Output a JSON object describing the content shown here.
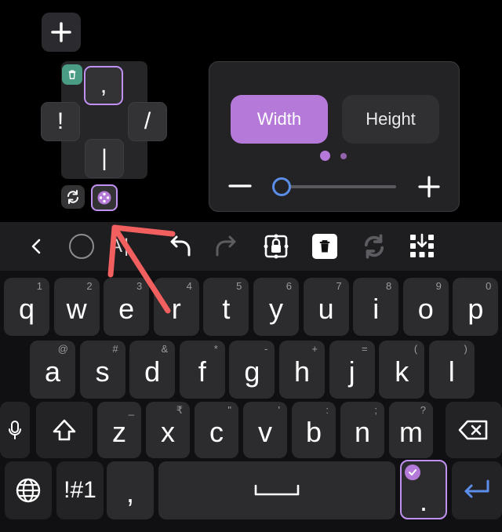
{
  "editor": {
    "add_icon": "plus-icon",
    "cluster": {
      "top_key": ",",
      "left_key": "!",
      "right_key": "/",
      "bottom_key": "|",
      "delete_icon": "trash-icon",
      "reset_icon": "refresh-icon",
      "move_icon": "drag-icon"
    },
    "size_panel": {
      "width_label": "Width",
      "height_label": "Height",
      "page_dots": 2,
      "active_page": 1,
      "slider_value_fraction": 0.1
    }
  },
  "toolbar": {
    "back_icon": "chevron-left-icon",
    "circle_icon": "circle-icon",
    "text_partial": "A|",
    "undo_icon": "undo-icon",
    "redo_icon": "redo-icon",
    "lock_icon": "lock-icon",
    "delete_icon": "trash-icon",
    "sync_icon": "refresh-icon",
    "layout_icon": "grid-download-icon"
  },
  "keyboard": {
    "row1": [
      {
        "main": "q",
        "hint": "1"
      },
      {
        "main": "w",
        "hint": "2"
      },
      {
        "main": "e",
        "hint": "3"
      },
      {
        "main": "r",
        "hint": "4"
      },
      {
        "main": "t",
        "hint": "5"
      },
      {
        "main": "y",
        "hint": "6"
      },
      {
        "main": "u",
        "hint": "7"
      },
      {
        "main": "i",
        "hint": "8"
      },
      {
        "main": "o",
        "hint": "9"
      },
      {
        "main": "p",
        "hint": "0"
      }
    ],
    "row2": [
      {
        "main": "a",
        "hint": "@"
      },
      {
        "main": "s",
        "hint": "#"
      },
      {
        "main": "d",
        "hint": "&"
      },
      {
        "main": "f",
        "hint": "*"
      },
      {
        "main": "g",
        "hint": "-"
      },
      {
        "main": "h",
        "hint": "+"
      },
      {
        "main": "j",
        "hint": "="
      },
      {
        "main": "k",
        "hint": "("
      },
      {
        "main": "l",
        "hint": ")"
      }
    ],
    "row3": [
      {
        "main": "z",
        "hint": "_"
      },
      {
        "main": "x",
        "hint": "₹"
      },
      {
        "main": "c",
        "hint": "\""
      },
      {
        "main": "v",
        "hint": "'"
      },
      {
        "main": "b",
        "hint": ":"
      },
      {
        "main": "n",
        "hint": ";"
      },
      {
        "main": "m",
        "hint": "?"
      }
    ],
    "symbols_label": "!#1",
    "comma_label": ",",
    "period_label": ".",
    "mic_icon": "mic-icon",
    "shift_icon": "shift-icon",
    "backspace_icon": "backspace-icon",
    "globe_icon": "globe-icon",
    "space_icon": "space-icon",
    "enter_icon": "enter-icon",
    "period_badge_icon": "check-badge-icon"
  },
  "colors": {
    "accent": "#b57ad9",
    "accent_border": "#c191f2",
    "enter_blue": "#5b8ee8",
    "annotation_red": "#f25f5f",
    "trash_badge": "#4a9c84"
  }
}
